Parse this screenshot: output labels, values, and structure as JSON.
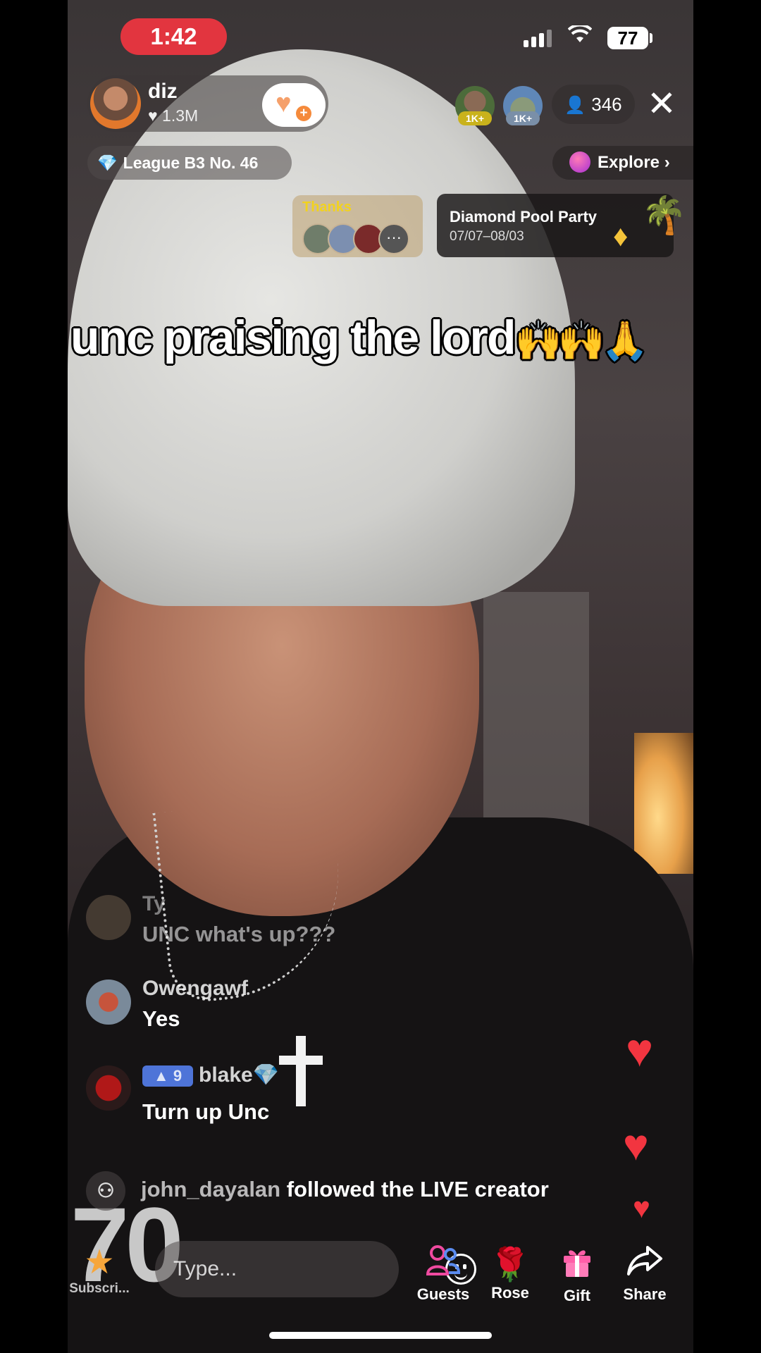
{
  "status_bar": {
    "time": "1:42",
    "battery": "77",
    "wifi_icon": "wifi-icon",
    "signal_icon": "signal-icon"
  },
  "host": {
    "name": "diz",
    "likes": "♥ 1.3M"
  },
  "top_viewers": [
    {
      "tag": "1K+"
    },
    {
      "tag": "1K+"
    }
  ],
  "viewer_count": "346",
  "league": "League B3 No. 46",
  "explore": "Explore ›",
  "thanks": {
    "label": "Thanks"
  },
  "promo": {
    "title": "Diamond Pool Party",
    "dates": "07/07–08/03"
  },
  "caption": {
    "text": "unc praising the lord",
    "emoji": "🙌🙌🙏"
  },
  "comments": [
    {
      "name": "Ty",
      "text": "UNC what's up???"
    },
    {
      "name": "Owengawf",
      "text": "Yes"
    },
    {
      "badge": "9",
      "name": "blake💎",
      "text": "Turn up Unc"
    }
  ],
  "follow_event": {
    "user": "john_dayalan",
    "text": "followed the LIVE creator"
  },
  "bottom_bar": {
    "subscribe_label": "Subscri...",
    "input_placeholder": "Type...",
    "actions": [
      {
        "label": "Guests",
        "icon": "guests-icon"
      },
      {
        "label": "Rose",
        "icon": "rose-icon"
      },
      {
        "label": "Gift",
        "icon": "gift-icon"
      },
      {
        "label": "Share",
        "icon": "share-icon"
      }
    ]
  },
  "colors": {
    "status_pill": "#e2353f",
    "heart": "#f23540",
    "league_badge": "#4e74d8",
    "guests_icon": "#f04aa0",
    "gift_icon": "#ff5fa8"
  }
}
